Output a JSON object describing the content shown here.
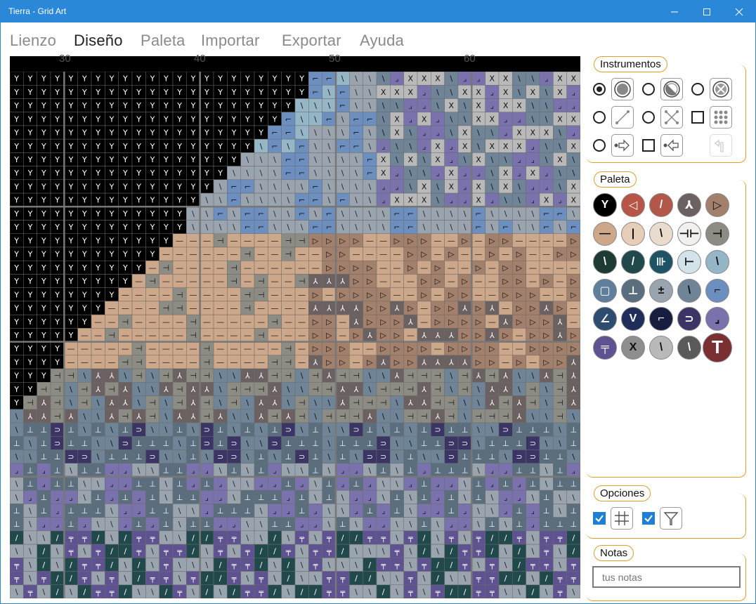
{
  "window": {
    "title": "Tierra - Grid Art"
  },
  "menu": [
    "Lienzo",
    "Diseño",
    "Paleta",
    "Importar",
    "Exportar",
    "Ayuda"
  ],
  "menu_active": "Diseño",
  "ruler": {
    "labels": [
      "30",
      "40",
      "50",
      "60"
    ]
  },
  "panels": {
    "instrumentos": "Instrumentos",
    "paleta": "Paleta",
    "opciones": "Opciones",
    "notas": "Notas"
  },
  "tools": [
    {
      "name": "fill-circle",
      "selected": true
    },
    {
      "name": "half-circle",
      "selected": false
    },
    {
      "name": "x-circle",
      "selected": false
    },
    {
      "name": "line",
      "selected": false
    },
    {
      "name": "cross-line",
      "selected": false
    },
    {
      "name": "dot-grid",
      "selected": false
    },
    {
      "name": "arrow-right",
      "selected": false
    },
    {
      "name": "arrow-left",
      "selected": false
    },
    {
      "name": "return-arrow",
      "selected": false
    }
  ],
  "palette": [
    {
      "color": "#000000",
      "symbol": "Y",
      "fg": "#ffffff"
    },
    {
      "color": "#b75546",
      "symbol": "◁",
      "fg": "#ffffff"
    },
    {
      "color": "#b1584a",
      "symbol": "/",
      "fg": "#ffffff"
    },
    {
      "color": "#6b6160",
      "symbol": "⅄",
      "fg": "#ffffff"
    },
    {
      "color": "#a2806c",
      "symbol": "▷",
      "fg": "#111111"
    },
    {
      "color": "#cda78a",
      "symbol": "—",
      "fg": "#111111"
    },
    {
      "color": "#e6cdb7",
      "symbol": "|",
      "fg": "#111111"
    },
    {
      "color": "#e9dccd",
      "symbol": "\\",
      "fg": "#111111"
    },
    {
      "color": "#f1f0ee",
      "symbol": "⊣⊢",
      "fg": "#111111"
    },
    {
      "color": "#8c8c84",
      "symbol": "⊣",
      "fg": "#111111"
    },
    {
      "color": "#1d3b34",
      "symbol": "\\",
      "fg": "#ffffff"
    },
    {
      "color": "#21494c",
      "symbol": "/",
      "fg": "#ffffff"
    },
    {
      "color": "#1e5365",
      "symbol": "⊪",
      "fg": "#ffffff"
    },
    {
      "color": "#d3e3ea",
      "symbol": "⊢",
      "fg": "#111111"
    },
    {
      "color": "#95b6c7",
      "symbol": "\\",
      "fg": "#111111"
    },
    {
      "color": "#5f7f9c",
      "symbol": "▢",
      "fg": "#ffffff"
    },
    {
      "color": "#5b6e7e",
      "symbol": "⊥",
      "fg": "#ffffff"
    },
    {
      "color": "#9aa4ae",
      "symbol": "±",
      "fg": "#111111"
    },
    {
      "color": "#6f8497",
      "symbol": "\\",
      "fg": "#111111"
    },
    {
      "color": "#6d8fbf",
      "symbol": "⌐",
      "fg": "#111111"
    },
    {
      "color": "#2d4c6f",
      "symbol": "∠",
      "fg": "#ffffff"
    },
    {
      "color": "#1f2d5a",
      "symbol": "V",
      "fg": "#ffffff"
    },
    {
      "color": "#161d3e",
      "symbol": "⌐",
      "fg": "#ffffff"
    },
    {
      "color": "#3a3565",
      "symbol": "⊃",
      "fg": "#ffffff"
    },
    {
      "color": "#7a72ad",
      "symbol": "⌟",
      "fg": "#111111"
    },
    {
      "color": "#5e5390",
      "symbol": "╤",
      "fg": "#ffffff"
    },
    {
      "color": "#8e8e8e",
      "symbol": "X",
      "fg": "#111111"
    },
    {
      "color": "#b9b9b9",
      "symbol": "\\",
      "fg": "#111111"
    },
    {
      "color": "#5a5a5a",
      "symbol": "\\",
      "fg": "#ffffff"
    },
    {
      "color": "#7a2f33",
      "symbol": "T",
      "fg": "#ffffff"
    }
  ],
  "options": [
    {
      "name": "grid-lines",
      "checked": true
    },
    {
      "name": "symbols",
      "checked": true
    }
  ],
  "notes": {
    "placeholder": "tus notas"
  }
}
